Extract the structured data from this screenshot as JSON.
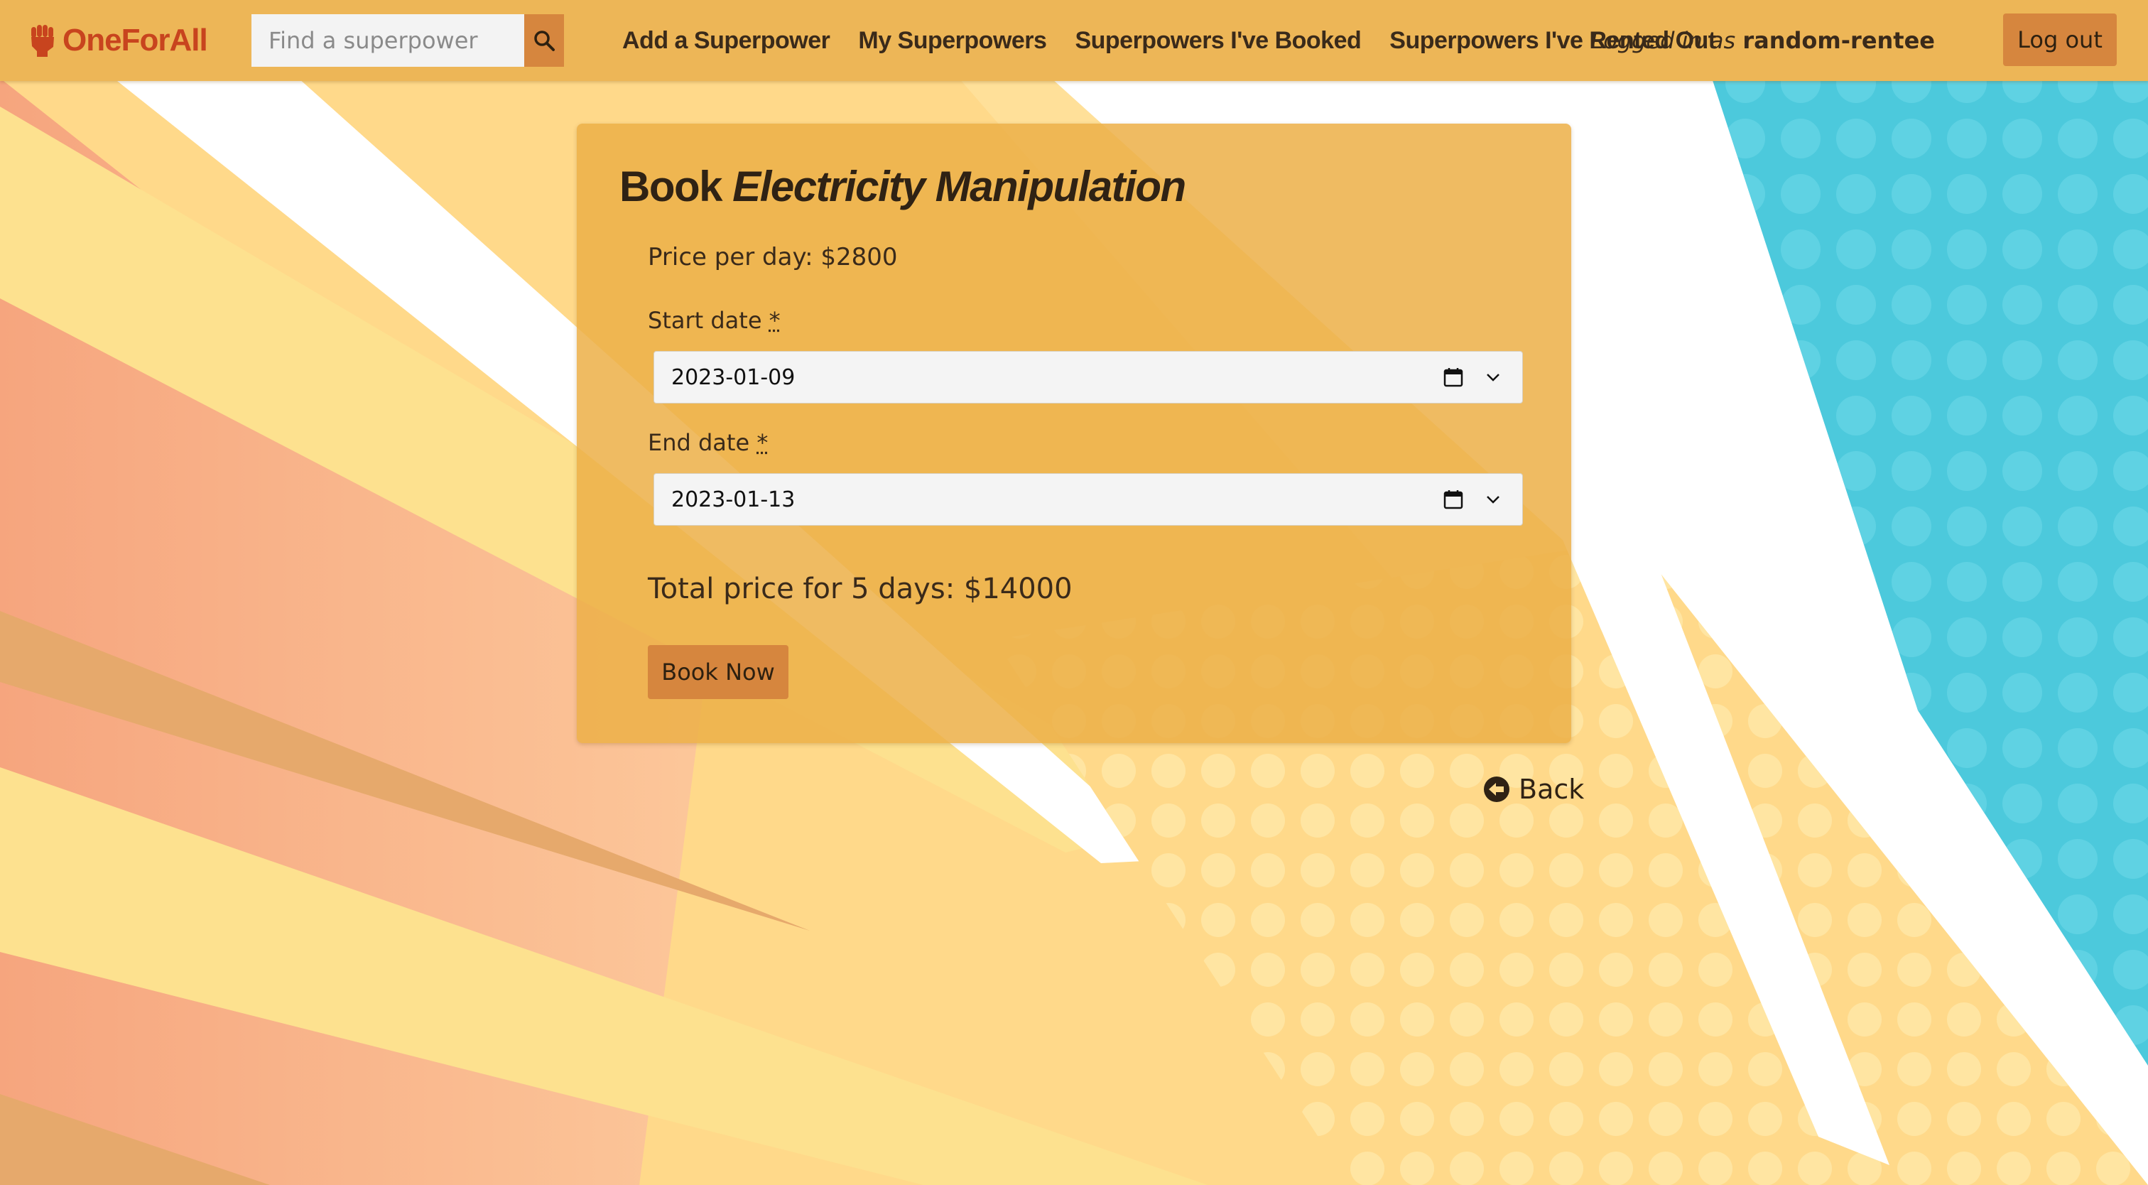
{
  "brand": {
    "name": "OneForAll",
    "icon": "fist-icon",
    "color": "#c8441e"
  },
  "search": {
    "placeholder": "Find a superpower",
    "value": "",
    "icon": "search-icon"
  },
  "nav": {
    "links": [
      {
        "label": "Add a Superpower"
      },
      {
        "label": "My Superpowers"
      },
      {
        "label": "Superpowers I've Booked"
      },
      {
        "label": "Superpowers I've Rented Out"
      }
    ],
    "logged_prefix": "Logged in as",
    "username": "random-rentee",
    "logout_label": "Log out"
  },
  "booking": {
    "title_prefix": "Book",
    "power_name": "Electricity Manipulation",
    "price_per_day": "Price per day: $2800",
    "start_label": "Start date",
    "start_value": "2023-01-09",
    "end_label": "End date",
    "end_value": "2023-01-13",
    "required_mark": "*",
    "total": "Total price for 5 days: $14000",
    "book_label": "Book Now"
  },
  "back": {
    "label": "Back",
    "icon": "arrow-circle-left-icon"
  },
  "colors": {
    "navbar": "#edb657",
    "button": "#d6863e",
    "card": "#ecb048",
    "accent_blue": "#4cc9dc"
  }
}
